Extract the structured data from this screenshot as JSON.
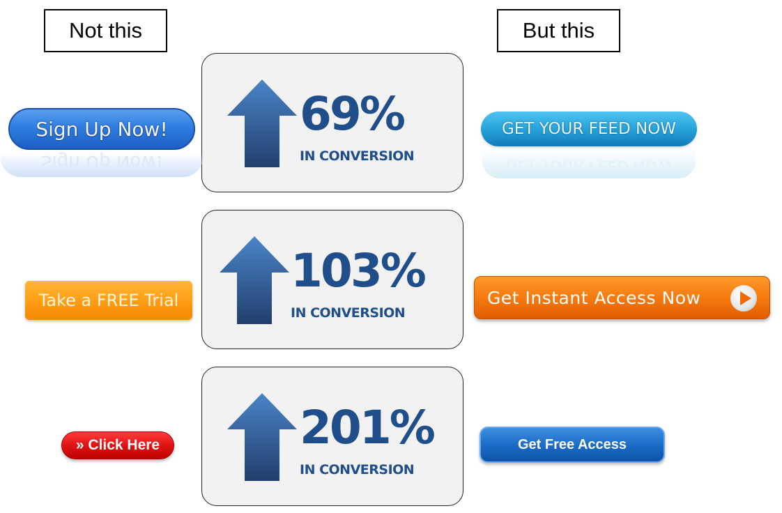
{
  "headers": {
    "left": "Not this",
    "right": "But this"
  },
  "stats": [
    {
      "value": "69%",
      "caption": "IN CONVERSION"
    },
    {
      "value": "103%",
      "caption": "IN CONVERSION"
    },
    {
      "value": "201%",
      "caption": "IN CONVERSION"
    }
  ],
  "before_buttons": [
    {
      "label": "Sign Up Now!",
      "color": "#2f7ee0"
    },
    {
      "label": "Take a FREE Trial",
      "color": "#ff9c12"
    },
    {
      "label": "» Click Here",
      "color": "#e01414"
    }
  ],
  "after_buttons": [
    {
      "label": "GET YOUR FEED NOW",
      "color": "#2aa7dd"
    },
    {
      "label": "Get Instant Access Now",
      "color": "#f57a10",
      "icon": "play-icon"
    },
    {
      "label": "Get Free Access",
      "color": "#1c6cc8"
    }
  ],
  "colors": {
    "stat_text": "#1f4e8a",
    "card_bg": "#f2f2f2"
  }
}
